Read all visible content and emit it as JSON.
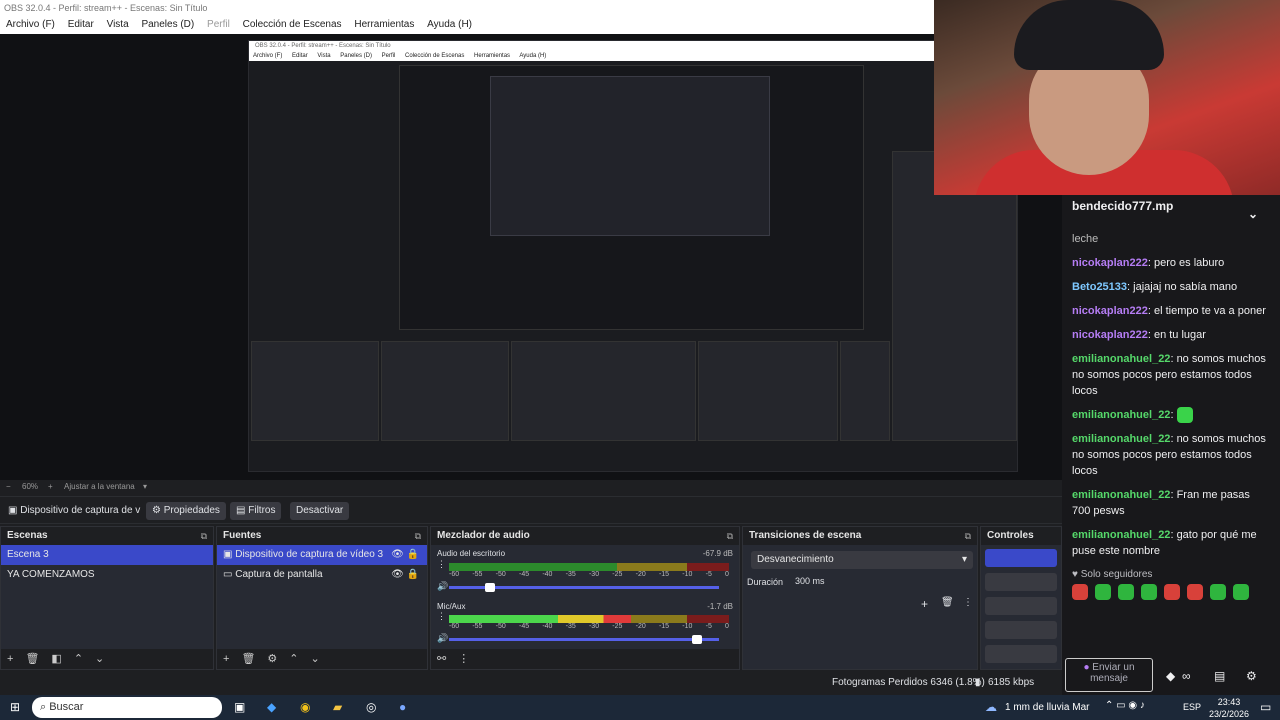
{
  "window": {
    "title": "OBS 32.0.4 - Perfil: stream++ - Escenas: Sin Título",
    "menu": [
      "Archivo (F)",
      "Editar",
      "Vista",
      "Paneles (D)",
      "Perfil",
      "Colección de Escenas",
      "Herramientas",
      "Ayuda (H)"
    ]
  },
  "preview": {
    "title": "OBS 32.0.4 - Perfil: stream++ - Escenas: Sin Título",
    "menu": [
      "Archivo (F)",
      "Editar",
      "Vista",
      "Paneles (D)",
      "Perfil",
      "Colección de Escenas",
      "Herramientas",
      "Ayuda (H)"
    ]
  },
  "toolbar": {
    "zoom": "60%",
    "fit": "Ajustar a la ventana"
  },
  "source_bar": {
    "source": "Dispositivo de captura de v",
    "properties": "Propiedades",
    "filters": "Filtros",
    "deactivate": "Desactivar"
  },
  "scenes": {
    "title": "Escenas",
    "items": [
      "Escena 3",
      "YA COMENZAMOS"
    ]
  },
  "sources": {
    "title": "Fuentes",
    "items": [
      "Dispositivo de captura de vídeo 3",
      "Captura de pantalla"
    ]
  },
  "mixer": {
    "title": "Mezclador de audio",
    "channels": [
      {
        "name": "Audio del escritorio",
        "db": "-67.9 dB",
        "level": 0,
        "volume": 0.15
      },
      {
        "name": "Mic/Aux",
        "db": "-1.7 dB",
        "level": 0.65,
        "volume": 0.92
      }
    ],
    "ticks": [
      "-60",
      "-55",
      "-50",
      "-45",
      "-40",
      "-35",
      "-30",
      "-25",
      "-20",
      "-15",
      "-10",
      "-5",
      "0"
    ]
  },
  "transitions": {
    "title": "Transiciones de escena",
    "type": "Desvanecimiento",
    "duration_label": "Duración",
    "duration_value": "300 ms"
  },
  "controls": {
    "title": "Controles"
  },
  "status": {
    "dropped": "Fotogramas Perdidos 6346 (1.8%)",
    "bitrate": "6185 kbps"
  },
  "chat": {
    "pinned": "bendecido777.mp",
    "partial": "leche",
    "messages": [
      {
        "user": "nicokaplan222",
        "color": "u1",
        "text": "pero es laburo"
      },
      {
        "user": "Beto25133",
        "color": "u2",
        "text": "jajajaj no sabía mano"
      },
      {
        "user": "nicokaplan222",
        "color": "u1",
        "text": "el tiempo te va a poner"
      },
      {
        "user": "nicokaplan222",
        "color": "u1",
        "text": "en tu lugar"
      },
      {
        "user": "emilianonahuel_22",
        "color": "u3",
        "text": "no somos muchos no somos pocos pero estamos todos locos"
      },
      {
        "user": "emilianonahuel_22",
        "color": "u3",
        "text": ""
      },
      {
        "user": "emilianonahuel_22",
        "color": "u3",
        "text": "no somos muchos no somos pocos pero estamos todos locos"
      },
      {
        "user": "emilianonahuel_22",
        "color": "u3",
        "text": "Fran me pasas 700 pesws"
      },
      {
        "user": "emilianonahuel_22",
        "color": "u3",
        "text": "gato por qué me puse este nombre"
      }
    ],
    "subs_only": "Solo seguidores",
    "send_placeholder": "Enviar un mensaje"
  },
  "taskbar": {
    "search": "Buscar",
    "weather": "1 mm de lluvia Mar",
    "lang": "ESP",
    "time": "23:43",
    "date": "23/2/2026"
  }
}
